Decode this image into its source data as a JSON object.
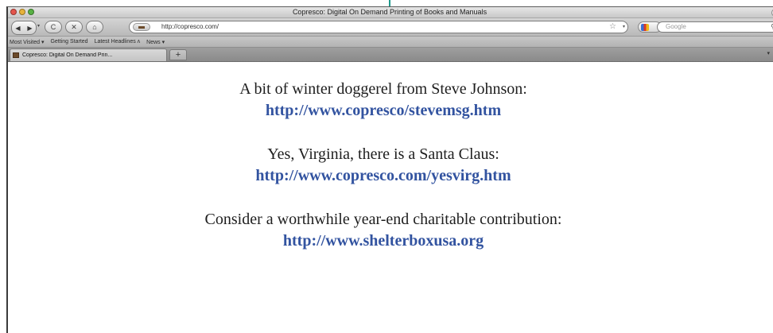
{
  "browser": {
    "window_title": "Copresco: Digital On Demand Printing of Books and Manuals",
    "url": "http://copresco.com/",
    "search_placeholder": "Google",
    "bookmarks": [
      "Most Visited ▾",
      "Getting Started",
      "Latest Headlines ʌ",
      "News ▾"
    ],
    "tab_title": "Copresco: Digital On Demand Prin...",
    "new_tab_label": "+",
    "icons": {
      "back": "◀",
      "forward": "▶",
      "reload": "C",
      "stop": "✕",
      "home": "⌂",
      "star": "☆",
      "dropdown": "▾",
      "search": "⚲"
    }
  },
  "page": {
    "entries": [
      {
        "text": "A bit of winter doggerel from Steve Johnson:",
        "link": "http://www.copresco/stevemsg.htm"
      },
      {
        "text": "Yes, Virginia, there is a Santa Claus:",
        "link": "http://www.copresco.com/yesvirg.htm"
      },
      {
        "text": "Consider a worthwhile year-end charitable contribution:",
        "link": "http://www.shelterboxusa.org"
      }
    ],
    "link_color": "#3253a0"
  }
}
